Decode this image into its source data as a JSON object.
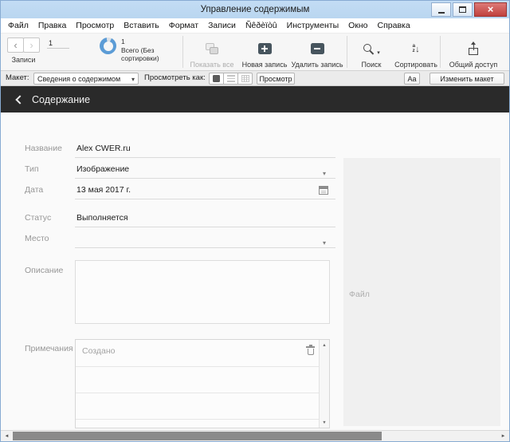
{
  "window": {
    "title": "Управление содержимым"
  },
  "menu": {
    "items": [
      "Файл",
      "Правка",
      "Просмотр",
      "Вставить",
      "Формат",
      "Записи",
      "Ñêðèïòû",
      "Инструменты",
      "Окно",
      "Справка"
    ]
  },
  "toolbar": {
    "records_label": "Записи",
    "record_number": "1",
    "total_count": "1",
    "total_label": "Всего (Без сортировки)",
    "show_all_label": "Показать все",
    "new_record_label": "Новая запись",
    "delete_record_label": "Удалить запись",
    "find_label": "Поиск",
    "sort_label": "Сортировать",
    "share_label": "Общий доступ"
  },
  "layout_bar": {
    "layout_label": "Макет:",
    "layout_value": "Сведения о содержимом",
    "view_as_label": "Просмотреть как:",
    "preview_label": "Просмотр",
    "format_label": "Aa",
    "edit_layout_label": "Изменить макет"
  },
  "content_header": {
    "title": "Содержание"
  },
  "form": {
    "fields": {
      "name": {
        "label": "Название",
        "value": "Alex CWER.ru"
      },
      "type": {
        "label": "Тип",
        "value": "Изображение"
      },
      "date": {
        "label": "Дата",
        "value": "13 мая 2017 г."
      },
      "status": {
        "label": "Статус",
        "value": "Выполняется"
      },
      "place": {
        "label": "Место",
        "value": ""
      },
      "description": {
        "label": "Описание",
        "value": ""
      },
      "notes": {
        "label": "Примечания",
        "rows": [
          {
            "value": "Создано"
          }
        ]
      }
    },
    "file_panel_label": "Файл"
  },
  "colors": {
    "titlebar": "#bcd7f1",
    "close_button": "#c0413e",
    "header_dark": "#2a2a2a",
    "accent_blue": "#5c9cd6"
  }
}
